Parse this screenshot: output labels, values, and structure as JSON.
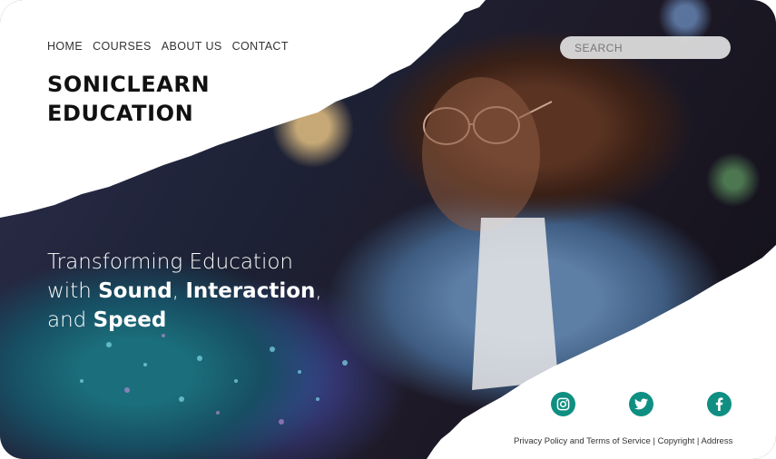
{
  "nav": {
    "items": [
      {
        "label": "HOME"
      },
      {
        "label": "COURSES"
      },
      {
        "label": "ABOUT US"
      },
      {
        "label": "CONTACT"
      }
    ]
  },
  "brand": {
    "line1": "SONICLEARN",
    "line2": "EDUCATION"
  },
  "search": {
    "placeholder": "SEARCH"
  },
  "hero": {
    "tagline_part1": "Transforming Education",
    "tagline_part2": "with ",
    "tagline_bold1": "Sound",
    "tagline_part3": ", ",
    "tagline_bold2": "Interaction",
    "tagline_part4": ",",
    "tagline_part5": "and ",
    "tagline_bold3": "Speed"
  },
  "social": {
    "items": [
      {
        "icon": "instagram-icon"
      },
      {
        "icon": "twitter-icon"
      },
      {
        "icon": "facebook-icon"
      }
    ],
    "color": "#0f8f82"
  },
  "footer": {
    "privacy": "Privacy Policy and Terms of Service",
    "sep1": " | ",
    "copyright": "Copyright",
    "sep2": " |  ",
    "address": "Address"
  }
}
